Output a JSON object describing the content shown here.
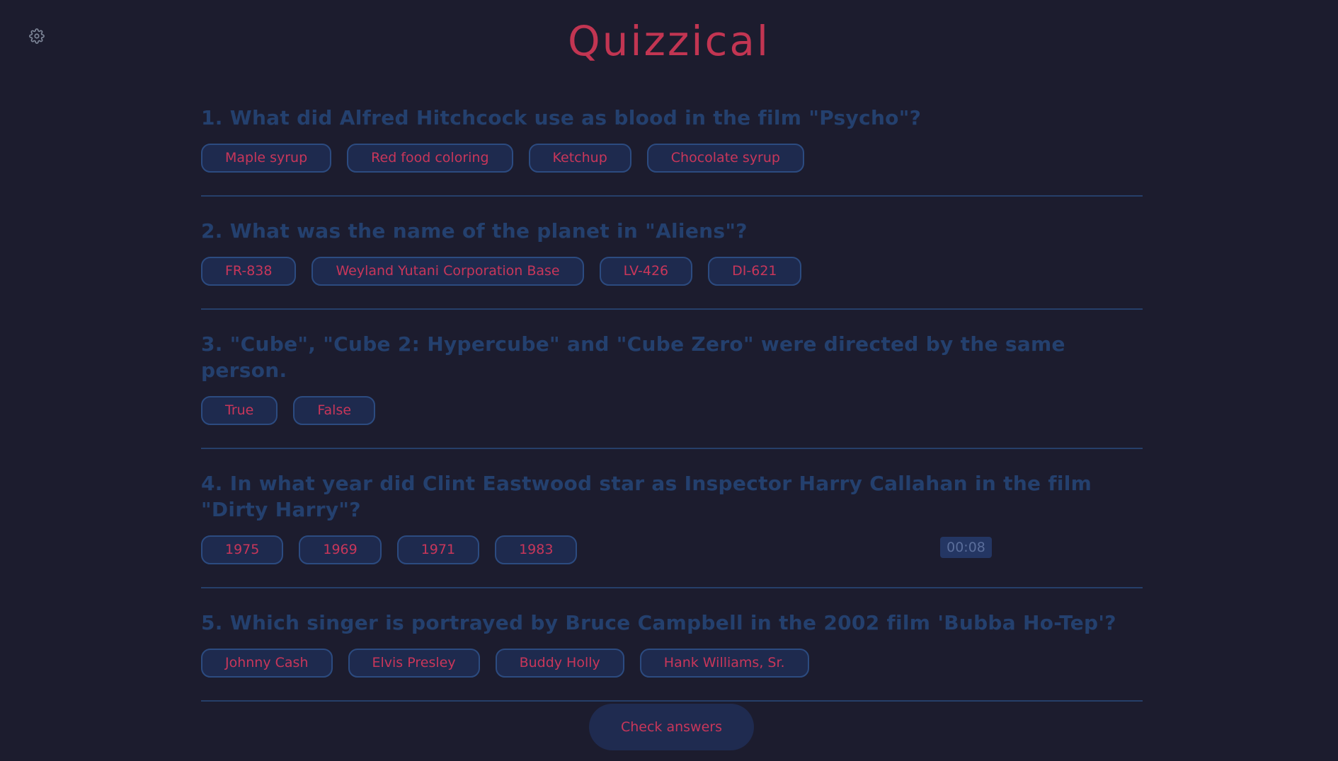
{
  "app": {
    "title": "Quizzical"
  },
  "settings": {
    "icon": "gear-icon"
  },
  "questions": [
    {
      "text": "1. What did Alfred Hitchcock use as blood in the film \"Psycho\"?",
      "answers": [
        "Maple syrup",
        "Red food coloring",
        "Ketchup",
        "Chocolate syrup"
      ]
    },
    {
      "text": "2. What was the name of the planet in \"Aliens\"?",
      "answers": [
        "FR-838",
        "Weyland Yutani Corporation Base",
        "LV-426",
        "DI-621"
      ]
    },
    {
      "text": "3. \"Cube\", \"Cube 2: Hypercube\" and \"Cube Zero\" were directed by the same person.",
      "answers": [
        "True",
        "False"
      ]
    },
    {
      "text": "4. In what year did Clint Eastwood star as Inspector Harry Callahan in the film \"Dirty Harry\"?",
      "answers": [
        "1975",
        "1969",
        "1971",
        "1983"
      ]
    },
    {
      "text": "5. Which singer is portrayed by Bruce Campbell in the 2002 film 'Bubba Ho-Tep'?",
      "answers": [
        "Johnny Cash",
        "Elvis Presley",
        "Buddy Holly",
        "Hank Williams, Sr."
      ]
    }
  ],
  "timer": {
    "value": "00:08"
  },
  "check_button": {
    "label": "Check answers"
  },
  "colors": {
    "background": "#1c1c2e",
    "title": "#c23552",
    "question_text": "#24406e",
    "answer_text": "#c8365a",
    "answer_border": "#2c4b80",
    "divider": "#263f6a"
  }
}
